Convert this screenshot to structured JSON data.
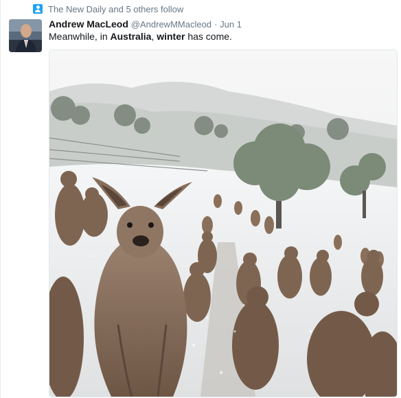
{
  "context": {
    "icon": "follow-user-icon",
    "text": "The New Daily and 5 others follow"
  },
  "tweet": {
    "author_name": "Andrew MacLeod",
    "author_handle": "@AndrewMMacleod",
    "separator": "·",
    "timestamp": "Jun 1",
    "text_parts": [
      "Meanwhile, in ",
      "Australia",
      ", ",
      "winter",
      " has come."
    ]
  },
  "media": {
    "description_icon": "photo",
    "colors": {
      "sky": "#f2f2f2",
      "snow": "#f4f5f6",
      "kangaroo": "#8a705a",
      "tree": "#6e7c6a"
    }
  },
  "colors": {
    "accent": "#1da1f2",
    "muted": "#657786",
    "text": "#14171a"
  }
}
